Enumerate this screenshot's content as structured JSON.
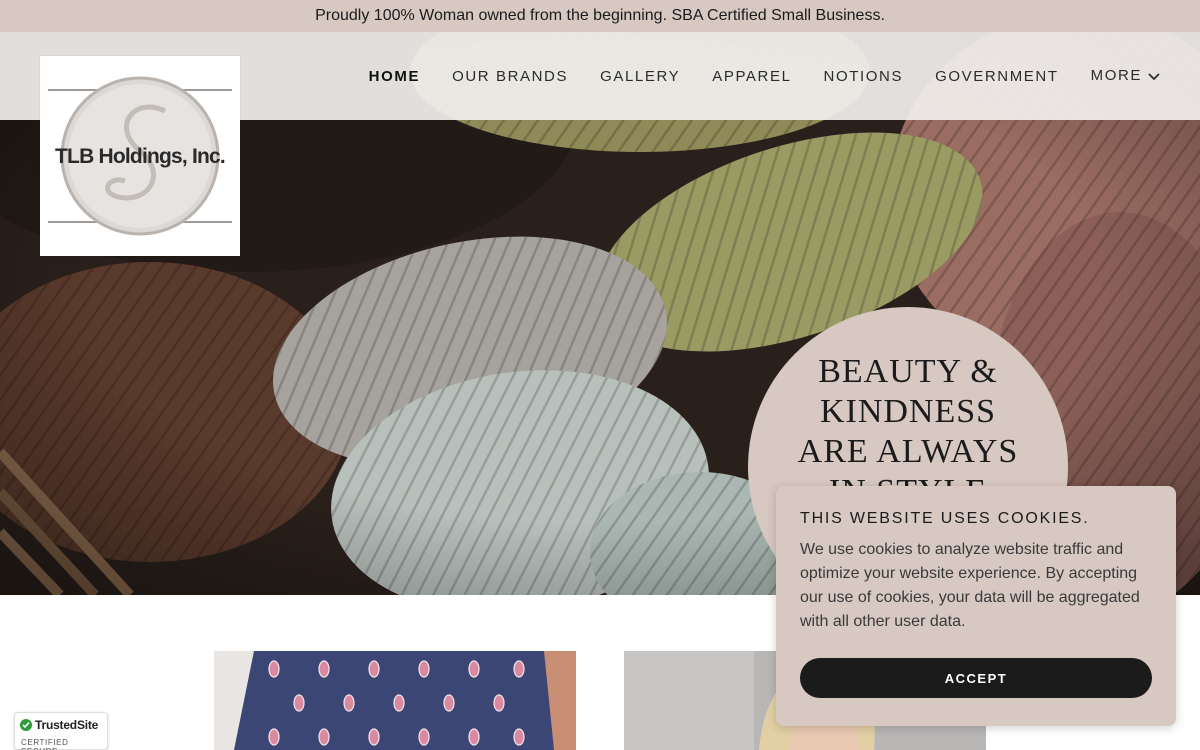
{
  "announcement": {
    "text": "Proudly 100% Woman owned from the beginning. SBA Certified Small Business."
  },
  "logo": {
    "company_name": "TLB Holdings, Inc."
  },
  "nav": {
    "items": [
      {
        "label": "HOME",
        "active": true
      },
      {
        "label": "OUR BRANDS"
      },
      {
        "label": "GALLERY"
      },
      {
        "label": "APPAREL"
      },
      {
        "label": "NOTIONS"
      },
      {
        "label": "GOVERNMENT"
      },
      {
        "label": "MORE",
        "icon": "chevron-down-icon"
      }
    ]
  },
  "hero": {
    "tagline_lines": [
      "BEAUTY &",
      "KINDNESS",
      "ARE ALWAYS",
      "IN STYLE"
    ]
  },
  "cookie_banner": {
    "title": "THIS WEBSITE USES COOKIES.",
    "body": "We use cookies to analyze website traffic and optimize your website experience. By accepting our use of cookies, your data will be aggregated with all other user data.",
    "accept_label": "ACCEPT"
  },
  "trust_badge": {
    "name": "TrustedSite",
    "subtitle": "CERTIFIED SECURE",
    "icon": "checkmark-icon"
  },
  "colors": {
    "accent": "#d7c8c1",
    "dark": "#1b1b1b",
    "badge_green": "#2e9b3b"
  }
}
